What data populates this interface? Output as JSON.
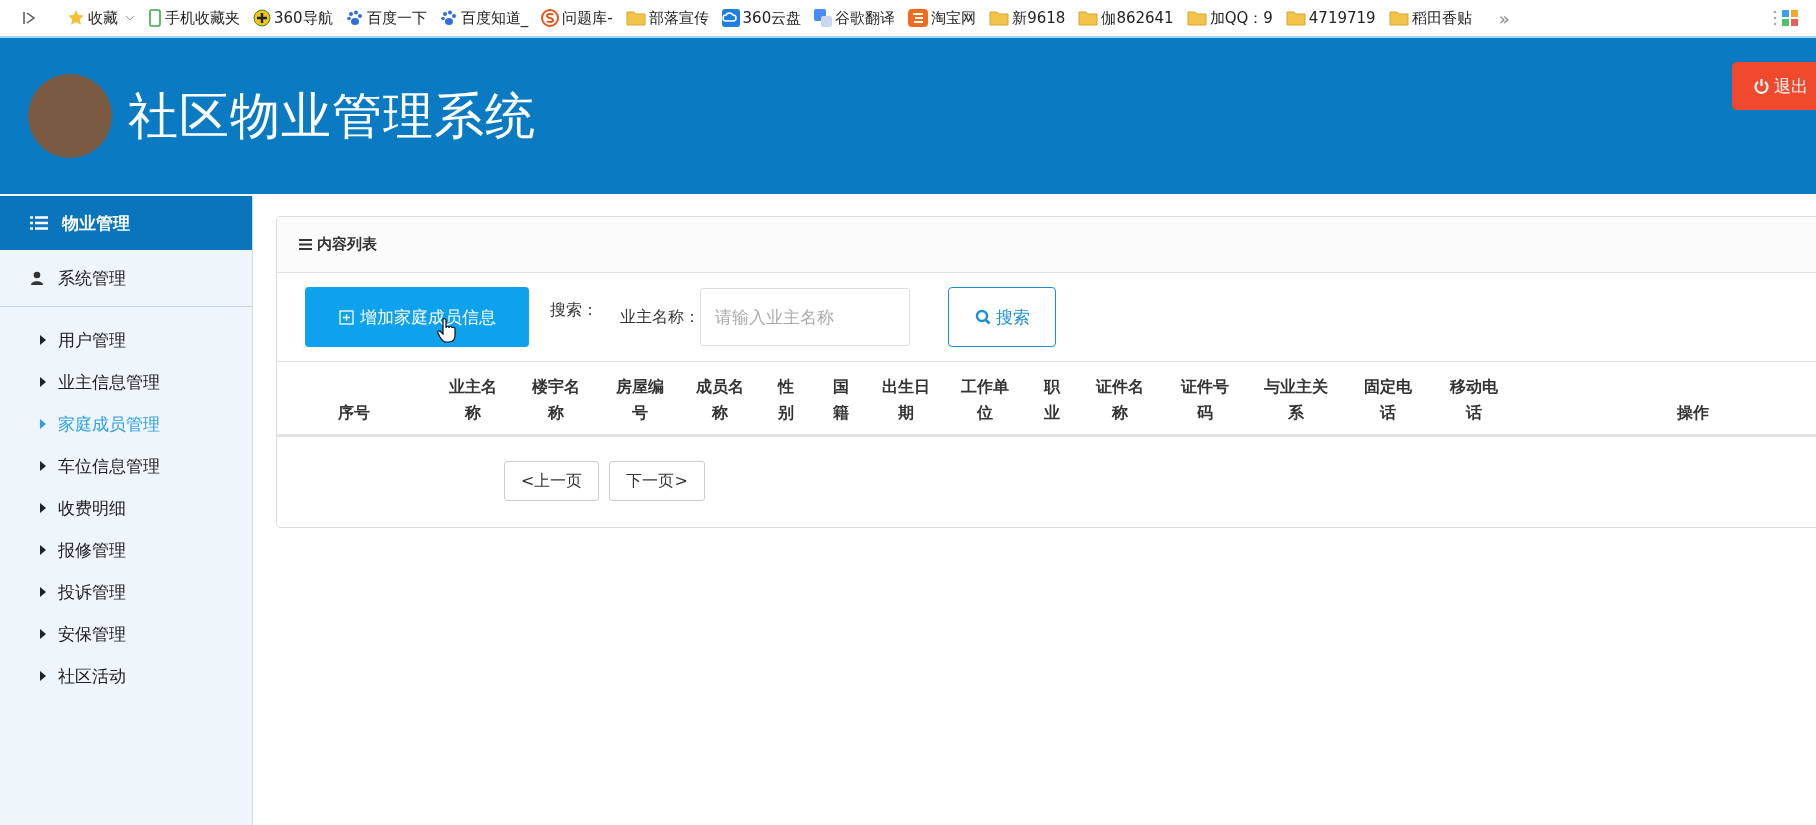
{
  "bookmarks": [
    {
      "kind": "star",
      "label": "收藏",
      "caret": true
    },
    {
      "kind": "phone",
      "label": "手机收藏夹",
      "caret": false
    },
    {
      "kind": "plus",
      "label": "360导航",
      "caret": false
    },
    {
      "kind": "paw",
      "label": "百度一下",
      "caret": false
    },
    {
      "kind": "paw",
      "label": "百度知道_",
      "caret": false
    },
    {
      "kind": "s",
      "label": "问题库-",
      "caret": false
    },
    {
      "kind": "folder",
      "label": "部落宣传",
      "caret": false
    },
    {
      "kind": "cloud",
      "label": "360云盘",
      "caret": false
    },
    {
      "kind": "translate",
      "label": "谷歌翻译",
      "caret": false
    },
    {
      "kind": "tao",
      "label": "淘宝网",
      "caret": false
    },
    {
      "kind": "folder",
      "label": "新9618",
      "caret": false
    },
    {
      "kind": "folder",
      "label": "伽862641",
      "caret": false
    },
    {
      "kind": "folder",
      "label": "加QQ：9",
      "caret": false
    },
    {
      "kind": "folder",
      "label": "4719719",
      "caret": false
    },
    {
      "kind": "folder",
      "label": "稻田香贴",
      "caret": false
    }
  ],
  "more": "»",
  "header": {
    "title": "社区物业管理系统",
    "logout": "退出"
  },
  "sidebar": {
    "title": "物业管理",
    "group": "系统管理",
    "items": [
      {
        "label": "用户管理",
        "selected": false
      },
      {
        "label": "业主信息管理",
        "selected": false
      },
      {
        "label": "家庭成员管理",
        "selected": true
      },
      {
        "label": "车位信息管理",
        "selected": false
      },
      {
        "label": "收费明细",
        "selected": false
      },
      {
        "label": "报修管理",
        "selected": false
      },
      {
        "label": "投诉管理",
        "selected": false
      },
      {
        "label": "安保管理",
        "selected": false
      },
      {
        "label": "社区活动",
        "selected": false
      }
    ]
  },
  "panel": {
    "title": "内容列表",
    "add_button": "增加家庭成员信息",
    "search_label": "搜索：",
    "field_label": "业主名称：",
    "search_field": {
      "placeholder": "请输入业主名称"
    },
    "search_button": "搜索",
    "table": {
      "columns": [
        "序号",
        "业主名称",
        "楼宇名称",
        "房屋编号",
        "成员名称",
        "性别",
        "国籍",
        "出生日期",
        "工作单位",
        "职业",
        "证件名称",
        "证件号码",
        "与业主关系",
        "固定电话",
        "移动电话",
        "操作"
      ]
    },
    "pagination": [
      "<上一页",
      "下一页>"
    ]
  }
}
